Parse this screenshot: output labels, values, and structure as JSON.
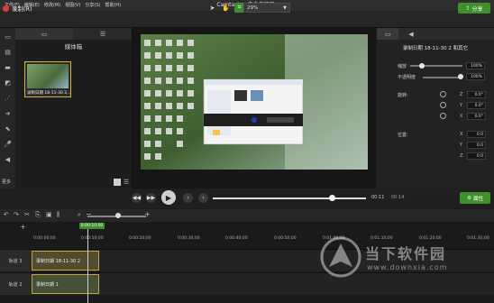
{
  "menu": [
    "文件(F)",
    "编辑(E)",
    "修改(M)",
    "视图(V)",
    "分享(S)",
    "帮助(H)"
  ],
  "app_title": "Camtasia - 未命名项目*",
  "window_buttons": [
    "−",
    "□",
    "✕"
  ],
  "toolbar": {
    "record_label": "录制(R)",
    "zoom_value": "29%",
    "share_label": "分享"
  },
  "media_bin": {
    "title": "媒体箱",
    "thumb_label": "录制日期 18-11-30 2...",
    "more_label": "更多"
  },
  "properties": {
    "title": "录制日期 18-11-30 2 和其它",
    "scale_label": "缩放",
    "scale_value": "100%",
    "opacity_label": "不透明度",
    "opacity_value": "100%",
    "rotation_label": "旋转:",
    "rot_axes": [
      "Z",
      "Y",
      "X"
    ],
    "rot_values": [
      "0.0°",
      "0.0°",
      "0.0°"
    ],
    "position_label": "位置:",
    "pos_axes": [
      "X",
      "Y",
      "Z"
    ],
    "pos_values": [
      "0.0",
      "0.0",
      "0.0"
    ]
  },
  "playback": {
    "current_time": "00:11",
    "total_time": "00:14",
    "properties_label": "属性",
    "progress": 0.78
  },
  "timeline": {
    "playhead_time": "0:00:10;00",
    "ticks": [
      "0:00:00;00",
      "0:00:10;00",
      "0:00:20;00",
      "0:00:30;00",
      "0:00:40;00",
      "0:00:50;00",
      "0:01:00;00",
      "0:01:10;00",
      "0:01:20;00",
      "0:01:30;00"
    ],
    "tracks": [
      {
        "name": "轨道 3",
        "clip": "录制日期 18-11-30 2"
      },
      {
        "name": "轨道 2",
        "clip": "录制日期 1"
      }
    ]
  },
  "watermark": {
    "text": "当下软件园",
    "url": "www.downxia.com"
  },
  "colors": {
    "accent_green": "#3f8f2a",
    "record_red": "#e53935",
    "clip_border": "#c9a43a"
  }
}
